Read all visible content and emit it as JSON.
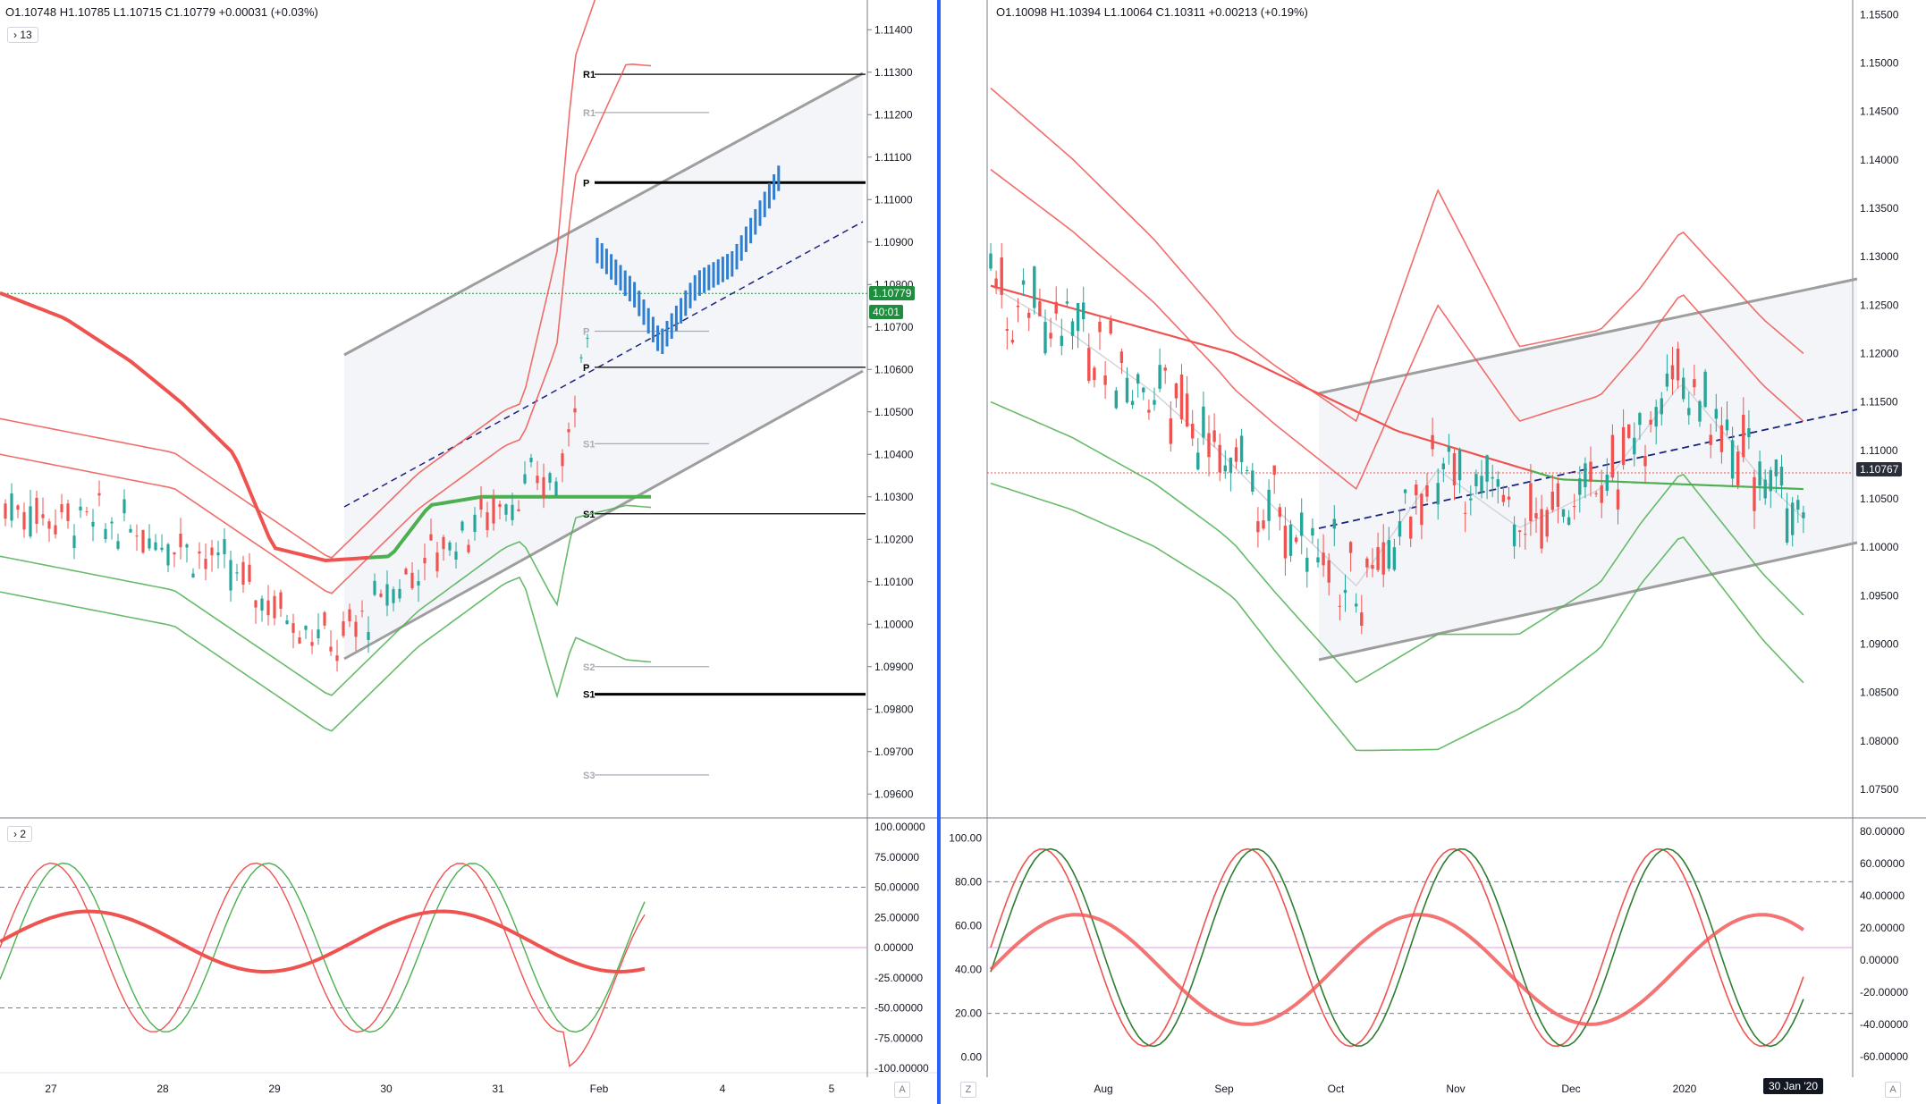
{
  "left_chart": {
    "ohlc_text": "O1.10748 H1.10785 L1.10715 C1.10779 +0.00031 (+0.03%)",
    "indicator_badge_main": "13",
    "indicator_badge_sub": "2",
    "last_price_tag": "1.10779",
    "countdown_tag": "40:01",
    "corner_button": "A",
    "chart_data": {
      "type": "candlestick",
      "price_axis": {
        "ylim": [
          1.0955,
          1.1147
        ],
        "tick_labels": [
          "1.11400",
          "1.11300",
          "1.11200",
          "1.11100",
          "1.11000",
          "1.10900",
          "1.10800",
          "1.10700",
          "1.10600",
          "1.10500",
          "1.10400",
          "1.10300",
          "1.10200",
          "1.10100",
          "1.10000",
          "1.09900",
          "1.09800",
          "1.09700",
          "1.09600"
        ]
      },
      "time_axis": {
        "tick_labels": [
          "27",
          "28",
          "29",
          "30",
          "31",
          "Feb",
          "4",
          "5"
        ]
      },
      "pivot_levels": [
        {
          "label": "R1",
          "value": 1.11295
        },
        {
          "label": "R1",
          "value": 1.11205
        },
        {
          "label": "P",
          "value": 1.1104
        },
        {
          "label": "P",
          "value": 1.1069
        },
        {
          "label": "P",
          "value": 1.10605
        },
        {
          "label": "S1",
          "value": 1.10425
        },
        {
          "label": "S1",
          "value": 1.1026
        },
        {
          "label": "S2",
          "value": 1.099
        },
        {
          "label": "S1",
          "value": 1.09835
        },
        {
          "label": "S3",
          "value": 1.09645
        }
      ],
      "last_close": 1.10779,
      "oscillator": {
        "ylim": [
          -100,
          100
        ],
        "tick_labels": [
          "100.00000",
          "75.00000",
          "50.00000",
          "25.00000",
          "0.00000",
          "-25.00000",
          "-50.00000",
          "-75.00000",
          "-100.00000"
        ],
        "levels": [
          -50,
          0,
          50
        ]
      }
    }
  },
  "right_chart": {
    "ohlc_text": "O1.10098 H1.10394 L1.10064 C1.10311 +0.00213 (+0.19%)",
    "last_price_tag": "1.10767",
    "date_tag": "30 Jan '20",
    "corner_button_left": "Z",
    "corner_button_right": "A",
    "chart_data": {
      "type": "candlestick",
      "price_axis": {
        "ylim": [
          1.0725,
          1.1565
        ],
        "tick_labels": [
          "1.15500",
          "1.15000",
          "1.14500",
          "1.14000",
          "1.13500",
          "1.13000",
          "1.12500",
          "1.12000",
          "1.11500",
          "1.11000",
          "1.10500",
          "1.10000",
          "1.09500",
          "1.09000",
          "1.08500",
          "1.08000",
          "1.07500"
        ]
      },
      "time_axis": {
        "tick_labels": [
          "Aug",
          "Sep",
          "Oct",
          "Nov",
          "Dec",
          "2020"
        ]
      },
      "last_close": 1.10767,
      "oscillator": {
        "ylim": [
          -5,
          105
        ],
        "left_tick_labels": [
          "100.00",
          "80.00",
          "60.00",
          "40.00",
          "20.00",
          "0.00"
        ],
        "right_tick_labels": [
          "80.00000",
          "60.00000",
          "40.00000",
          "20.00000",
          "0.00000",
          "-20.00000",
          "-40.00000",
          "-60.00000"
        ],
        "levels": [
          20,
          50,
          80
        ]
      }
    }
  },
  "colors": {
    "up": "#26a69a",
    "down": "#ef5350",
    "blue_bar": "#2f7fd1",
    "red_band": "#ef5350",
    "green_band": "#4caf50",
    "channel": "#9e9e9e",
    "midline": "#1a237e",
    "price_green": "#1e8e3e",
    "price_dark": "#2a2e39"
  }
}
